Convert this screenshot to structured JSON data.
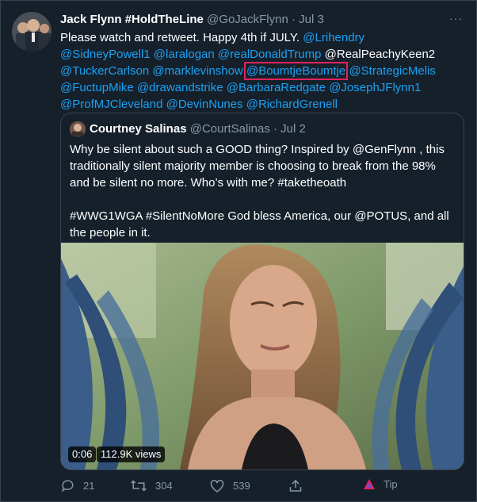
{
  "tweet": {
    "author_name": "Jack Flynn #HoldTheLine",
    "handle": "@GoJackFlynn",
    "separator": "·",
    "date": "Jul 3",
    "more": "···",
    "text": "Please watch and retweet. Happy 4th if JULY. ",
    "mentions": {
      "m1": "@Lrihendry",
      "m2": "@SidneyPowell1",
      "m3": "@laralogan",
      "m4": "@realDonaldTrump",
      "m5": "@RealPeachyKeen2",
      "m6": "@TuckerCarlson",
      "m7": "@marklevinshow",
      "m8": "@BoumtjeBoumtje",
      "m9": "@StrategicMelis",
      "m10": "@FuctupMike",
      "m11": "@drawandstrike",
      "m12": "@BarbaraRedgate",
      "m13": "@JosephJFlynn1",
      "m14": "@ProfMJCleveland",
      "m15": "@DevinNunes",
      "m16": "@RichardGrenell"
    }
  },
  "quote": {
    "author_name": "Courtney Salinas",
    "handle": "@CourtSalinas",
    "separator": "·",
    "date": "Jul 2",
    "text_a": "Why be silent about such a GOOD thing? Inspired by ",
    "mention": "@GenFlynn",
    "text_b": " , this traditionally silent majority member is choosing to break from the 98% and be silent no more. Who’s with me? #taketheoath",
    "text_c": "#WWG1WGA #SilentNoMore God bless America, our @POTUS, and all the people in it.",
    "video": {
      "duration": "0:06",
      "views": "112.9K views"
    }
  },
  "actions": {
    "replies": "21",
    "retweets": "304",
    "likes": "539",
    "tip": "Tip"
  }
}
